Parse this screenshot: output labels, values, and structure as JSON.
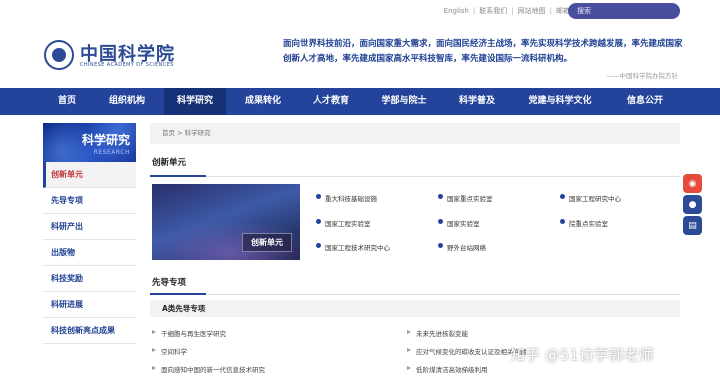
{
  "top_links": [
    "English",
    "联系我们",
    "网站地图",
    "邮箱"
  ],
  "search": {
    "placeholder": "搜索"
  },
  "logo": {
    "cn": "中国科学院",
    "en": "CHINESE ACADEMY OF SCIENCES"
  },
  "slogan": {
    "text": "面向世界科技前沿，面向国家重大需求，面向国民经济主战场，率先实现科学技术跨越发展，率先建成国家创新人才高地，率先建成国家高水平科技智库，率先建设国际一流科研机构。",
    "source": "——中国科学院办院方针"
  },
  "nav": [
    {
      "label": "首页"
    },
    {
      "label": "组织机构"
    },
    {
      "label": "科学研究"
    },
    {
      "label": "成果转化"
    },
    {
      "label": "人才教育"
    },
    {
      "label": "学部与院士"
    },
    {
      "label": "科学普及"
    },
    {
      "label": "党建与科学文化"
    },
    {
      "label": "信息公开"
    }
  ],
  "sidebar": {
    "title": "科学研究",
    "title_en": "RESEARCH",
    "items": [
      "创新单元",
      "先导专项",
      "科研产出",
      "出版物",
      "科技奖励",
      "科研进展",
      "科技创新亮点成果"
    ]
  },
  "breadcrumb": "首页 > 科学研究",
  "innovation": {
    "title": "创新单元",
    "banner_caption": "创新单元",
    "units": [
      "重大科技基础设施",
      "国家重点实验室",
      "国家工程研究中心",
      "国家工程实验室",
      "国家实验室",
      "院重点实验室",
      "国家工程技术研究中心",
      "野外台站网络"
    ]
  },
  "pilot": {
    "title": "先导专项",
    "subtitle": "A类先导专项",
    "projects": [
      "干细胞与再生医学研究",
      "未来先进核裂变能",
      "空间科学",
      "应对气候变化的碳收支认证及相关问题",
      "面向感知中国的新一代信息技术研究",
      "低阶煤清洁高效梯级利用"
    ]
  },
  "share_icons": [
    "weibo-icon",
    "wechat-icon",
    "comment-icon"
  ],
  "watermark": "知乎 @51访学郭老师"
}
